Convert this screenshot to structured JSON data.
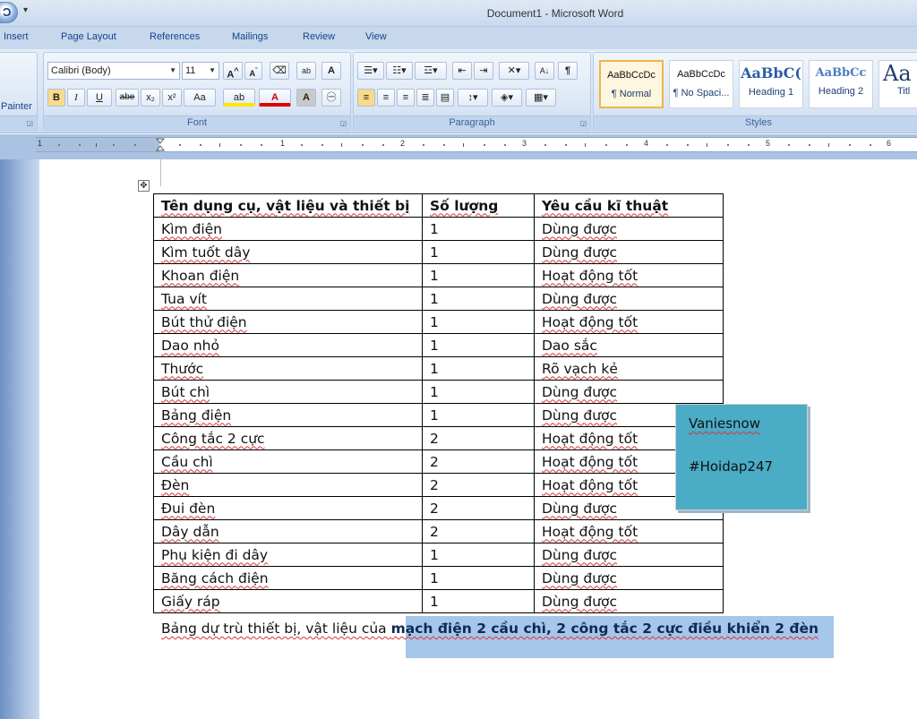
{
  "window": {
    "title": "Document1 - Microsoft Word",
    "office_button_glyph": "Ɔ",
    "qat_glyph": "₹"
  },
  "tabs": [
    "Insert",
    "Page Layout",
    "References",
    "Mailings",
    "Review",
    "View"
  ],
  "ribbon": {
    "clipboard": {
      "format_painter_label": "Painter"
    },
    "font": {
      "label": "Font",
      "font_name": "Calibri (Body)",
      "font_size": "11",
      "buttons": [
        "B",
        "I",
        "U",
        "abe",
        "x₂",
        "x²",
        "Aa"
      ]
    },
    "paragraph": {
      "label": "Paragraph"
    },
    "styles": {
      "label": "Styles",
      "items": [
        {
          "preview": "AaBbCcDc",
          "name": "¶ Normal"
        },
        {
          "preview": "AaBbCcDc",
          "name": "¶ No Spaci..."
        },
        {
          "preview": "AaBbC(",
          "name": "Heading 1"
        },
        {
          "preview": "AaBbCc",
          "name": "Heading 2"
        },
        {
          "preview": "Aa",
          "name": "Titl"
        }
      ]
    }
  },
  "ruler": {
    "numbers": [
      "1",
      "1",
      "2",
      "3",
      "4",
      "5",
      "6"
    ]
  },
  "document": {
    "table": {
      "headers": [
        "Tên dụng cụ, vật liệu và thiết bị",
        "Số lượng",
        "Yêu cầu kĩ thuật"
      ],
      "rows": [
        [
          "Kìm điện",
          "1",
          "Dùng được"
        ],
        [
          "Kìm tuốt dây",
          "1",
          "Dùng được"
        ],
        [
          "Khoan điện",
          "1",
          "Hoạt động tốt"
        ],
        [
          "Tua vít",
          "1",
          "Dùng được"
        ],
        [
          "Bút thử điện",
          "1",
          "Hoạt động tốt"
        ],
        [
          "Dao nhỏ",
          "1",
          "Dao sắc"
        ],
        [
          "Thước",
          "1",
          "Rõ vạch kẻ"
        ],
        [
          "Bút chì",
          "1",
          "Dùng được"
        ],
        [
          "Bảng điện",
          "1",
          "Dùng được"
        ],
        [
          "Công tắc 2 cực",
          "2",
          "Hoạt động tốt"
        ],
        [
          "Cầu chì",
          "2",
          "Hoạt động tốt"
        ],
        [
          "Đèn",
          "2",
          "Hoạt động tốt"
        ],
        [
          "Đui đèn",
          "2",
          "Dùng được"
        ],
        [
          "Dây dẫn",
          "2",
          "Hoạt động tốt"
        ],
        [
          "Phụ kiện đi dây",
          "1",
          "Dùng được"
        ],
        [
          "Băng cách điện",
          "1",
          "Dùng được"
        ],
        [
          "Giấy ráp",
          "1",
          "Dùng được"
        ]
      ]
    },
    "caption_plain": "Bảng dự trù thiết bị, vật liệu của ",
    "caption_bold": "mạch điện 2 cầu chì, 2 công tắc 2 cực điều khiển 2 đèn",
    "textbox": {
      "line1": "Vaniesnow",
      "line2": "#Hoidap247"
    }
  }
}
